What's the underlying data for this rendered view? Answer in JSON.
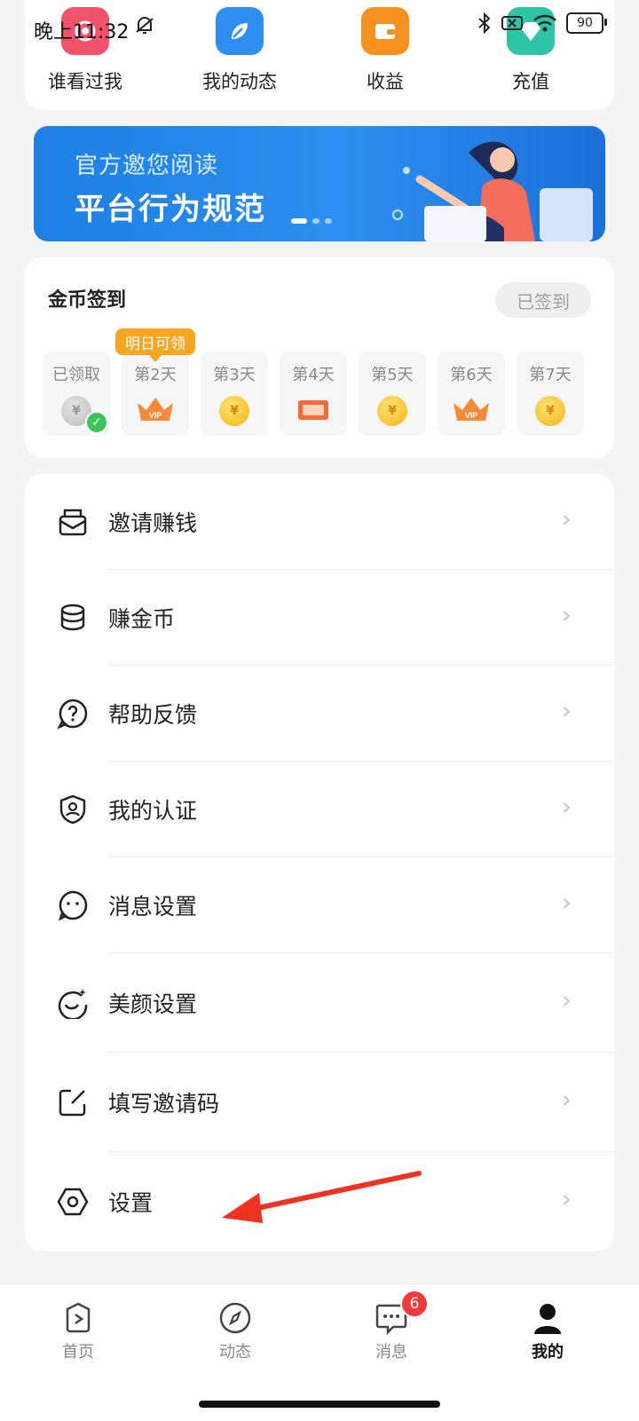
{
  "status_bar": {
    "time": "晚上11:32",
    "battery": "90"
  },
  "quick_actions": [
    {
      "label": "谁看过我",
      "icon": "eye-icon",
      "color": "#f2536b"
    },
    {
      "label": "我的动态",
      "icon": "leaf-icon",
      "color": "#2f8cf0"
    },
    {
      "label": "收益",
      "icon": "wallet-icon",
      "color": "#f5911e"
    },
    {
      "label": "充值",
      "icon": "diamond-icon",
      "color": "#2fc4a6"
    }
  ],
  "banner": {
    "subtitle": "官方邀您阅读",
    "title": "平台行为规范"
  },
  "checkin": {
    "title": "金币签到",
    "status_button": "已签到",
    "tomorrow_tag": "明日可领",
    "days": [
      {
        "label": "已领取",
        "reward": "coin",
        "claimed": true
      },
      {
        "label": "第2天",
        "reward": "vip"
      },
      {
        "label": "第3天",
        "reward": "coin"
      },
      {
        "label": "第4天",
        "reward": "card"
      },
      {
        "label": "第5天",
        "reward": "coin"
      },
      {
        "label": "第6天",
        "reward": "vip"
      },
      {
        "label": "第7天",
        "reward": "coin"
      }
    ],
    "coin_symbol": "¥",
    "vip_text": "VIP"
  },
  "menu": [
    {
      "label": "邀请赚钱",
      "icon": "invite-envelope-icon"
    },
    {
      "label": "赚金币",
      "icon": "coins-icon"
    },
    {
      "label": "帮助反馈",
      "icon": "help-icon"
    },
    {
      "label": "我的认证",
      "icon": "shield-user-icon"
    },
    {
      "label": "消息设置",
      "icon": "message-settings-icon"
    },
    {
      "label": "美颜设置",
      "icon": "beauty-icon"
    },
    {
      "label": "填写邀请码",
      "icon": "edit-icon"
    },
    {
      "label": "设置",
      "icon": "settings-hex-icon"
    }
  ],
  "chevron": "›",
  "bottom_nav": [
    {
      "label": "首页",
      "icon": "home-play-icon"
    },
    {
      "label": "动态",
      "icon": "compass-icon"
    },
    {
      "label": "消息",
      "icon": "chat-icon",
      "badge": "6"
    },
    {
      "label": "我的",
      "icon": "profile-icon",
      "active": true
    }
  ]
}
